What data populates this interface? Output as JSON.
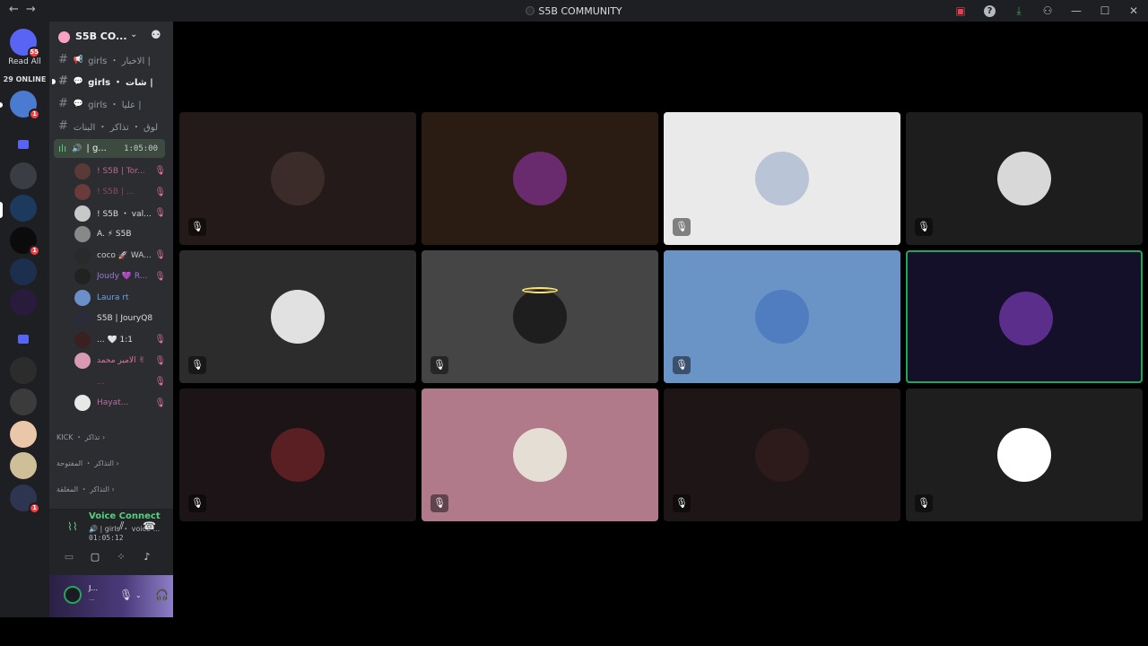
{
  "window": {
    "title": "S5B COMMUNITY",
    "nav_back": "←",
    "nav_forward": "→",
    "icons": [
      "screen-share-icon",
      "help-icon",
      "download-icon",
      "inbox-icon",
      "minimize-icon",
      "maximize-icon",
      "close-icon"
    ]
  },
  "server_rail": {
    "home_badge": "55",
    "read_all": "Read All",
    "online": "29 ONLINE",
    "servers": [
      {
        "badge": "1",
        "color": "#4a7bd0"
      },
      {
        "badge": "",
        "color": "#3a3d44"
      },
      {
        "badge": "",
        "color": "#1c3a5e"
      },
      {
        "badge": "1",
        "color": "#0b0b0b"
      },
      {
        "badge": "",
        "color": "#1d2f4e"
      },
      {
        "badge": "",
        "color": "#281b3c"
      },
      {
        "badge": "",
        "color": "#2c2c2c"
      },
      {
        "badge": "",
        "color": "#3b3b3b"
      },
      {
        "badge": "",
        "color": "#e9c7a8"
      },
      {
        "badge": "",
        "color": "#cfbf99"
      },
      {
        "badge": "1",
        "color": "#2e3550"
      }
    ]
  },
  "server": {
    "name": "S5B CO...",
    "channels": [
      {
        "label": "girls ・ الاخبار |",
        "emoji": "📢",
        "bold": false
      },
      {
        "label": "girls ・ شات |",
        "emoji": "💬",
        "bold": true
      },
      {
        "label": "girls ・ عليا |",
        "emoji": "💬",
        "bold": false
      },
      {
        "label": "لوق ・ تذاكر ・ البنات",
        "emoji": "",
        "bold": false
      }
    ],
    "voice_channel": {
      "label": "| g...",
      "time": "1:05:00"
    },
    "voice_users": [
      {
        "name": "! S5B | Tor...",
        "color": "#b36a93",
        "av": "#5a3a36"
      },
      {
        "name": "! S5B | ...",
        "color": "#8e4a5e",
        "av": "#6b3a3a"
      },
      {
        "name": "! S5B ・ val...",
        "color": "#dbdee1",
        "av": "#c8c8c8"
      },
      {
        "name": "A. ⚡ S5B",
        "color": "#dbdee1",
        "av": "#888888"
      },
      {
        "name": "coco 🚀 WA...",
        "color": "#c9c9c9",
        "av": "#2a2a2a"
      },
      {
        "name": "Joudy 💜 R...",
        "color": "#9a7ad1",
        "av": "#222222"
      },
      {
        "name": "Laura rt",
        "color": "#6fa1e8",
        "av": "#6a8fc9"
      },
      {
        "name": "S5B | JouryQ8",
        "color": "#dbdee1",
        "av": "#2b2b3a"
      },
      {
        "name": "... 🤍 1:1",
        "color": "#dbdee1",
        "av": "#3a2020"
      },
      {
        "name": "الأمير محمد ✌",
        "color": "#e2729e",
        "av": "#d79ab3"
      },
      {
        "name": "...",
        "color": "#b23a48",
        "av": "#2b2d31"
      },
      {
        "name": "Hayat...",
        "color": "#c06aa4",
        "av": "#e8e8e8"
      }
    ],
    "categories": [
      "KICK ・ تذاكر",
      "التذاكر ・ المفتوحة",
      "التذاكر ・ المغلقة"
    ]
  },
  "voice_panel": {
    "status": "Voice Connected",
    "channel": "🔊 | girls ・ voice ...",
    "time": "01:05:12"
  },
  "user_panel": {
    "name": "J...",
    "status": "..."
  },
  "tiles": [
    {
      "bg": "#231a19",
      "av": "#3b2c29",
      "speaking": false,
      "mic": true
    },
    {
      "bg": "#2a1c12",
      "av": "#6a2a6e",
      "speaking": false,
      "mic": false
    },
    {
      "bg": "#eaeaea",
      "av": "#b9c4d6",
      "speaking": false,
      "mic": true
    },
    {
      "bg": "#1d1d1d",
      "av": "#d8d8d8",
      "speaking": false,
      "mic": true
    },
    {
      "bg": "#2c2c2c",
      "av": "#e1e1e1",
      "speaking": false,
      "mic": true
    },
    {
      "bg": "#454545",
      "av": "#1e1e1e",
      "speaking": false,
      "mic": true
    },
    {
      "bg": "#6a93c6",
      "av": "#4f7dbf",
      "speaking": false,
      "mic": true
    },
    {
      "bg": "#15102a",
      "av": "#5b2e8c",
      "speaking": true,
      "mic": false
    },
    {
      "bg": "#1c1416",
      "av": "#5a1f22",
      "speaking": false,
      "mic": true
    },
    {
      "bg": "#b07a8a",
      "av": "#e4ded5",
      "speaking": false,
      "mic": true
    },
    {
      "bg": "#1e1616",
      "av": "#2d1a1a",
      "speaking": false,
      "mic": true
    },
    {
      "bg": "#1e1e1e",
      "av": "#ffffff",
      "speaking": false,
      "mic": true
    }
  ],
  "colors": {
    "speaking": "#23a55a",
    "danger": "#f23f43",
    "accent": "#5865f2"
  }
}
